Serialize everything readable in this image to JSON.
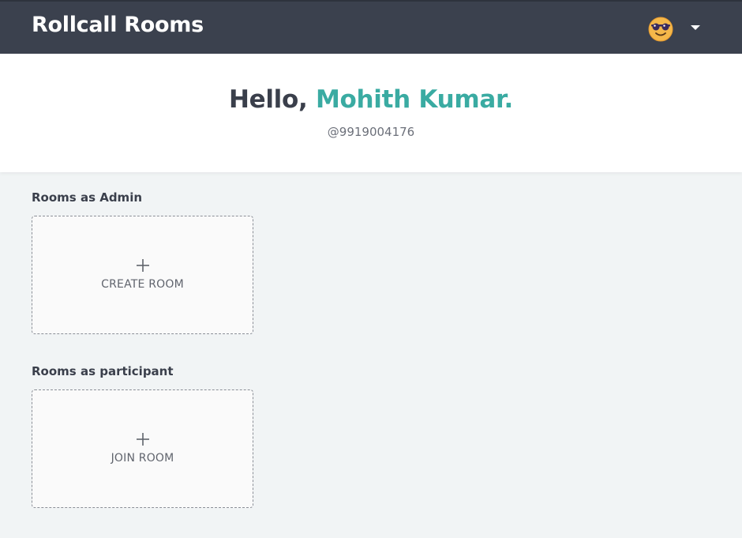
{
  "app": {
    "title": "Rollcall Rooms",
    "avatar_icon": "sunglasses-emoji-icon",
    "menu_icon": "caret-down-icon"
  },
  "greeting": {
    "prefix": "Hello,",
    "name": "Mohith Kumar.",
    "handle": "@9919004176"
  },
  "sections": {
    "admin": {
      "label": "Rooms as Admin",
      "card_label": "CREATE ROOM",
      "card_icon": "plus-icon"
    },
    "participant": {
      "label": "Rooms as participant",
      "card_label": "JOIN ROOM",
      "card_icon": "plus-icon"
    }
  },
  "colors": {
    "topbar": "#3b414e",
    "accent": "#3aaba2",
    "background": "#f1f4f5"
  }
}
